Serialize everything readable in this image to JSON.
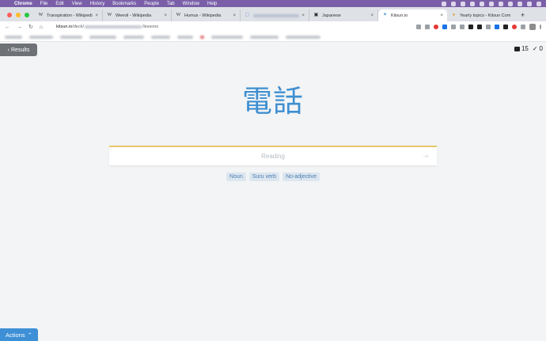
{
  "menubar": {
    "app": "Chrome",
    "items": [
      "File",
      "Edit",
      "View",
      "History",
      "Bookmarks",
      "People",
      "Tab",
      "Window",
      "Help"
    ]
  },
  "tabs": [
    {
      "favicon": "W",
      "title": "Transpiration - Wikipedia",
      "close": "×"
    },
    {
      "favicon": "W",
      "title": "Weevil - Wikipedia",
      "close": "×"
    },
    {
      "favicon": "W",
      "title": "Humus - Wikipedia",
      "close": "×"
    },
    {
      "favicon": "▢",
      "title": "",
      "close": "×"
    },
    {
      "favicon": "▣",
      "title": "Japanese",
      "close": "×"
    },
    {
      "favicon": "✦",
      "title": "Kitsun.io",
      "close": "×"
    },
    {
      "favicon": "●",
      "title": "Yearly topics - Kitsun Com",
      "close": ""
    }
  ],
  "newtab": "+",
  "toolbar": {
    "back": "←",
    "forward": "→",
    "reload": "↻",
    "home": "⌂",
    "url_host": "kitsun.io",
    "url_prefix": "/deck/",
    "url_suffix": "/lessons"
  },
  "page": {
    "results_label": "Results",
    "results_chevron": "‹",
    "counter_remaining": "15",
    "counter_done": "0",
    "kanji": "電話",
    "reading_placeholder": "Reading",
    "submit_arrow": "→",
    "tags": [
      "Noun",
      "Suru verb",
      "No-adjective"
    ],
    "actions_label": "Actions",
    "actions_chevron": "⌃"
  },
  "colors": {
    "accent": "#3d8fd6",
    "kanji": "#3f8fd0",
    "answer_border": "#e8c66a",
    "tag_bg": "#dce6ef",
    "tag_text": "#4a7eb5"
  }
}
